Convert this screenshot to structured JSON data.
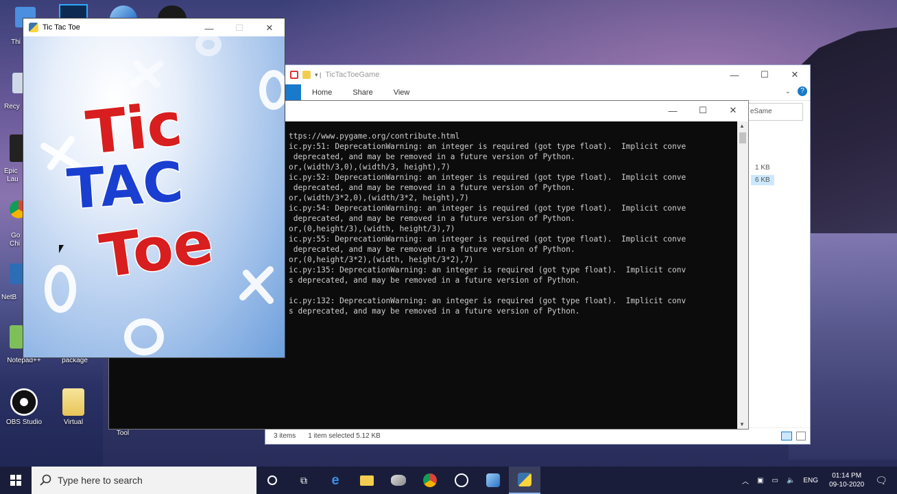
{
  "desktop": {
    "icons": [
      {
        "label": "OBS Studio"
      },
      {
        "label": "Virtual"
      },
      {
        "label": "Notepad++"
      },
      {
        "label": "package"
      },
      {
        "label": "Tool"
      }
    ],
    "partial_labels": [
      "Thi",
      "Recy",
      "Epic",
      "Lau",
      "Go",
      "Chi",
      "NetB"
    ]
  },
  "game_window": {
    "title": "Tic Tac Toe",
    "logo": {
      "line1": "Tic",
      "line2": "TAC",
      "line3": "Toe"
    }
  },
  "explorer": {
    "title": "TicTacToeGame",
    "ribbon_tabs": [
      "Home",
      "Share",
      "View"
    ],
    "address_fragment": "eSame",
    "sizes": [
      "1 KB",
      "6 KB"
    ],
    "status": {
      "items": "3 items",
      "selected": "1 item selected  5.12 KB"
    }
  },
  "console": {
    "lines": [
      "ttps://www.pygame.org/contribute.html",
      "ic.py:51: DeprecationWarning: an integer is required (got type float).  Implicit conve",
      " deprecated, and may be removed in a future version of Python.",
      "or,(width/3,0),(width/3, height),7)",
      "ic.py:52: DeprecationWarning: an integer is required (got type float).  Implicit conve",
      " deprecated, and may be removed in a future version of Python.",
      "or,(width/3*2,0),(width/3*2, height),7)",
      "ic.py:54: DeprecationWarning: an integer is required (got type float).  Implicit conve",
      " deprecated, and may be removed in a future version of Python.",
      "or,(0,height/3),(width, height/3),7)",
      "ic.py:55: DeprecationWarning: an integer is required (got type float).  Implicit conve",
      " deprecated, and may be removed in a future version of Python.",
      "or,(0,height/3*2),(width, height/3*2),7)",
      "ic.py:135: DeprecationWarning: an integer is required (got type float).  Implicit conv",
      "s deprecated, and may be removed in a future version of Python.",
      "",
      "ic.py:132: DeprecationWarning: an integer is required (got type float).  Implicit conv",
      "s deprecated, and may be removed in a future version of Python."
    ]
  },
  "taskbar": {
    "search_placeholder": "Type here to search",
    "language": "ENG",
    "time": "01:14 PM",
    "date": "09-10-2020"
  },
  "colors": {
    "tic": "#d81e1e",
    "tac": "#1a3fd0",
    "toe": "#d81e1e",
    "explorer_file_tab": "#1979ca"
  }
}
